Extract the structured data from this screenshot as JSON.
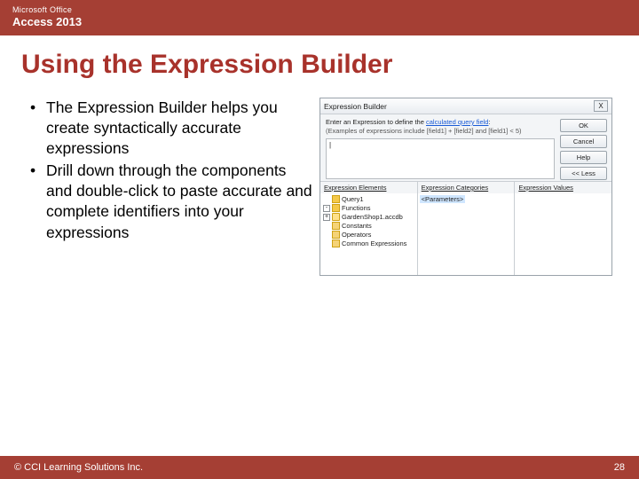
{
  "header": {
    "brand": "Microsoft Office",
    "product": "Access 2013"
  },
  "title": "Using the Expression Builder",
  "bullets": [
    "The Expression Builder helps you create syntactically accurate expressions",
    "Drill down through the components and double-click to paste accurate and complete identifiers into your expressions"
  ],
  "dialog": {
    "title": "Expression Builder",
    "close": "X",
    "hint_prefix": "Enter an Expression to define the ",
    "hint_link": "calculated query field",
    "hint_suffix": ":",
    "example": "(Examples of expressions include [field1] + [field2] and [field1] < 5)",
    "expr_value": "|",
    "buttons": {
      "ok": "OK",
      "cancel": "Cancel",
      "help": "Help",
      "less": "<< Less"
    },
    "cols": {
      "elements": {
        "header": "Expression Elements",
        "items": [
          {
            "toggle": "",
            "icon": "fx",
            "label": "Query1"
          },
          {
            "toggle": "-",
            "icon": "fx",
            "label": "Functions"
          },
          {
            "toggle": "+",
            "icon": "db",
            "label": "GardenShop1.accdb"
          },
          {
            "toggle": "",
            "icon": "folder",
            "label": "Constants"
          },
          {
            "toggle": "",
            "icon": "folder",
            "label": "Operators"
          },
          {
            "toggle": "",
            "icon": "folder",
            "label": "Common Expressions"
          }
        ]
      },
      "categories": {
        "header": "Expression Categories",
        "selected": "<Parameters>"
      },
      "values": {
        "header": "Expression Values"
      }
    }
  },
  "footer": {
    "copyright": "© CCI Learning Solutions Inc.",
    "page": "28"
  }
}
